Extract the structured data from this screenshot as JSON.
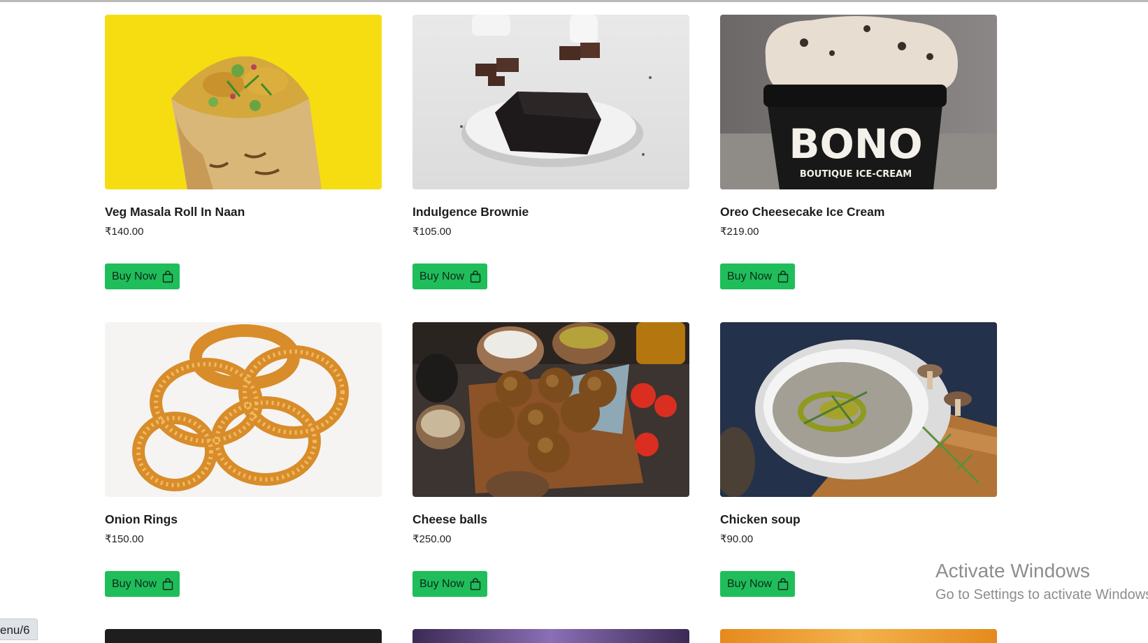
{
  "products": [
    {
      "name": "Veg Masala Roll In Naan",
      "price": "₹140.00",
      "button": "Buy Now"
    },
    {
      "name": "Indulgence Brownie",
      "price": "₹105.00",
      "button": "Buy Now"
    },
    {
      "name": "Oreo Cheesecake Ice Cream",
      "price": "₹219.00",
      "button": "Buy Now",
      "image_text": "BONO",
      "image_subtext": "BOUTIQUE ICE-CREAM"
    },
    {
      "name": "Onion Rings",
      "price": "₹150.00",
      "button": "Buy Now"
    },
    {
      "name": "Cheese balls",
      "price": "₹250.00",
      "button": "Buy Now"
    },
    {
      "name": "Chicken soup",
      "price": "₹90.00",
      "button": "Buy Now"
    }
  ],
  "colors": {
    "buy_button": "#1fbe5b",
    "roll_background": "#f5dd12"
  },
  "icons": {
    "buy_button": "shopping-bag-icon"
  },
  "status_bar": {
    "url": "enu/6"
  },
  "watermark": {
    "title": "Activate Windows",
    "subtitle": "Go to Settings to activate Windows."
  }
}
